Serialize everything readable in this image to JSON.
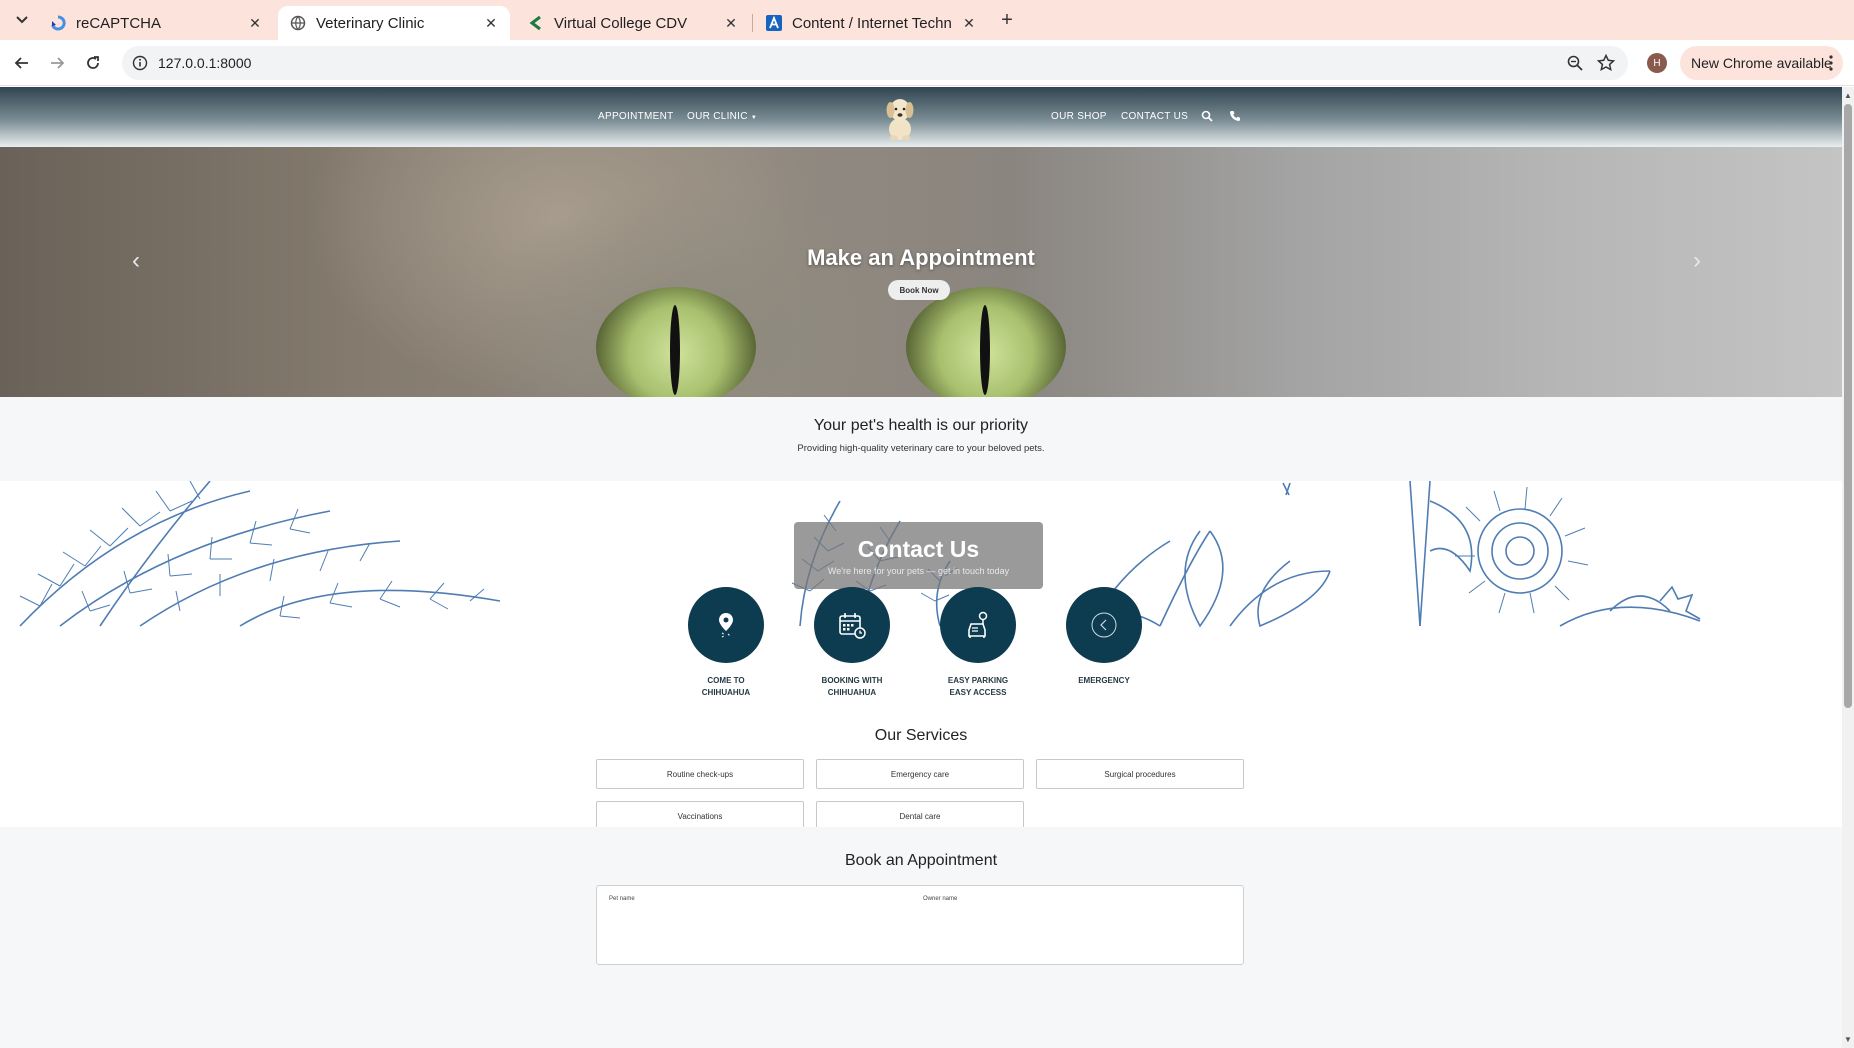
{
  "browser": {
    "tabs": [
      {
        "title": "reCAPTCHA",
        "active": false
      },
      {
        "title": "Veterinary Clinic",
        "active": true
      },
      {
        "title": "Virtual College CDV",
        "active": false
      },
      {
        "title": "Content / Internet Techn",
        "active": false
      }
    ],
    "url": "127.0.0.1:8000",
    "profile_initial": "H",
    "update_label": "New Chrome available"
  },
  "site": {
    "nav": {
      "appointment": "APPOINTMENT",
      "our_clinic": "OUR CLINIC",
      "our_shop": "OUR SHOP",
      "contact_us": "CONTACT US"
    },
    "hero": {
      "title": "Make an Appointment",
      "button": "Book Now"
    },
    "priority": {
      "heading": "Your pet's health is our priority",
      "subtext": "Providing high-quality veterinary care to your beloved pets."
    },
    "contact": {
      "heading": "Contact Us",
      "subtext": "We're here for your pets — get in touch today"
    },
    "features": [
      {
        "line1": "COME TO",
        "line2": "CHIHUAHUA",
        "icon": "location-pin-icon"
      },
      {
        "line1": "BOOKING WITH",
        "line2": "CHIHUAHUA",
        "icon": "calendar-icon"
      },
      {
        "line1": "EASY PARKING",
        "line2": "EASY ACCESS",
        "icon": "parking-icon"
      },
      {
        "line1": "EMERGENCY",
        "line2": "",
        "icon": "emergency-icon"
      }
    ],
    "services": {
      "title": "Our Services",
      "items": [
        "Routine check-ups",
        "Emergency care",
        "Surgical procedures",
        "Vaccinations",
        "Dental care"
      ]
    },
    "booking": {
      "title": "Book an Appointment",
      "pet_name_label": "Pet name",
      "owner_name_label": "Owner name"
    }
  },
  "colors": {
    "tabstrip": "#fce4dc",
    "feature_circle": "#0d3b4f",
    "botanical_blue": "#4f7db3"
  }
}
